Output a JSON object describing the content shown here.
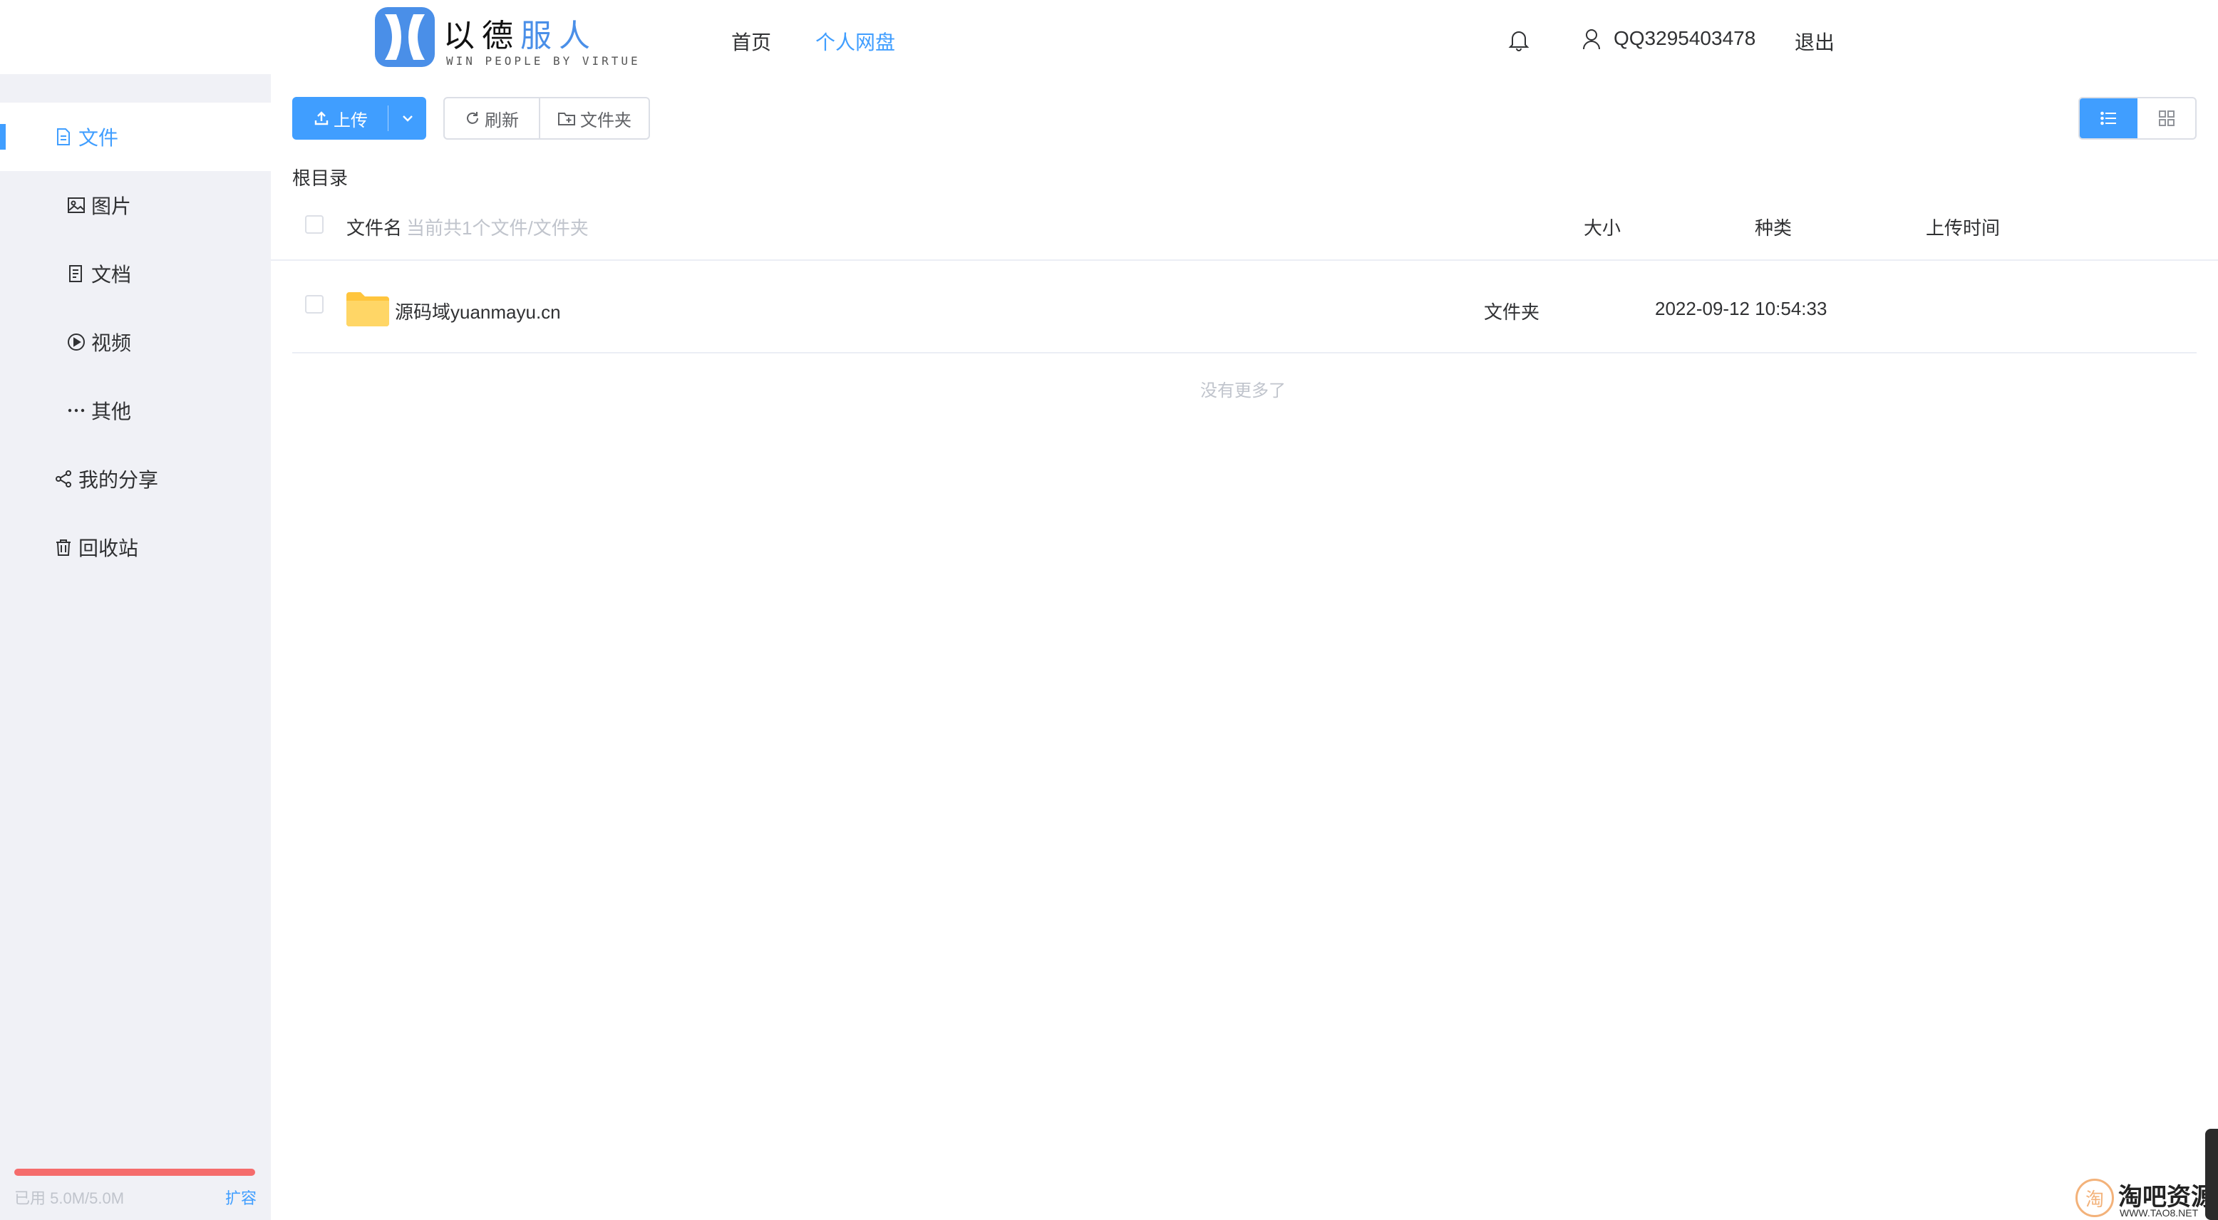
{
  "header": {
    "logo_cn_part1": "以德",
    "logo_cn_part2": "服人",
    "logo_en": "WIN PEOPLE BY VIRTUE",
    "nav": [
      {
        "label": "首页",
        "active": false
      },
      {
        "label": "个人网盘",
        "active": true
      }
    ],
    "notification_icon": "bell-icon",
    "user_icon": "user-icon",
    "username": "QQ3295403478",
    "logout_label": "退出"
  },
  "sidebar": {
    "items": [
      {
        "label": "文件",
        "icon": "file-icon",
        "active": true
      },
      {
        "label": "图片",
        "icon": "image-icon",
        "active": false
      },
      {
        "label": "文档",
        "icon": "document-icon",
        "active": false
      },
      {
        "label": "视频",
        "icon": "play-icon",
        "active": false
      },
      {
        "label": "其他",
        "icon": "more-icon",
        "active": false
      },
      {
        "label": "我的分享",
        "icon": "share-icon",
        "active": false
      },
      {
        "label": "回收站",
        "icon": "trash-icon",
        "active": false
      }
    ],
    "storage_used_fraction": 1.0,
    "storage_text": "已用 5.0M/5.0M",
    "expand_label": "扩容"
  },
  "toolbar": {
    "upload_label": "上传",
    "refresh_label": "刷新",
    "new_folder_label": "文件夹",
    "view_mode": "list"
  },
  "breadcrumb": "根目录",
  "table": {
    "columns": {
      "name": "文件名",
      "name_hint": "当前共1个文件/文件夹",
      "size": "大小",
      "type": "种类",
      "time": "上传时间"
    },
    "rows": [
      {
        "name": "源码域yuanmayu.cn",
        "size": "",
        "type": "文件夹",
        "time": "2022-09-12 10:54:33",
        "icon": "folder-icon"
      }
    ],
    "footer": "没有更多了"
  },
  "watermark": {
    "circle_char": "淘",
    "text": "淘吧资源",
    "url": "WWW.TAO8.NET"
  },
  "colors": {
    "primary": "#409eff",
    "sidebar_bg": "#f0f1f6",
    "storage_bar": "#f56c6c",
    "folder": "#ffc53d"
  }
}
